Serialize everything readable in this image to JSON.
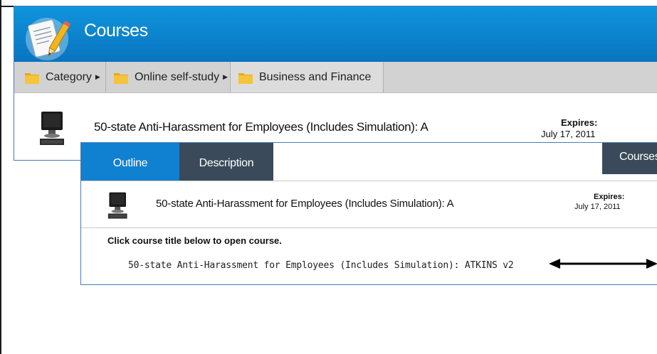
{
  "panel1": {
    "header_title": "Courses",
    "breadcrumb": [
      {
        "label": "Category"
      },
      {
        "label": "Online self-study"
      },
      {
        "label": "Business and Finance"
      }
    ],
    "course": {
      "title": "50-state Anti-Harassment for Employees (Includes Simulation): A",
      "expires_label": "Expires:",
      "expires_date": "July 17, 2011"
    }
  },
  "panel2": {
    "tabs": {
      "outline": "Outline",
      "description": "Description",
      "courses": "Courses"
    },
    "course": {
      "title": "50-state Anti-Harassment for Employees (Includes Simulation): A",
      "expires_label": "Expires:",
      "expires_date": "July 17, 2011"
    },
    "instruction": "Click course title below to open course.",
    "link": "50-state Anti-Harassment for Employees (Includes Simulation): ATKINS v2"
  },
  "colors": {
    "header_blue": "#0f95dc",
    "tab_active": "#1080d0",
    "tab_dark": "#3a4a5a",
    "breadcrumb_gray": "#d2d2d2",
    "folder_gold": "#f2b51e"
  },
  "icons": {
    "header": "document-pencil-icon",
    "breadcrumb": "folder-icon",
    "course": "computer-icon",
    "pointer": "double-arrow-icon"
  }
}
